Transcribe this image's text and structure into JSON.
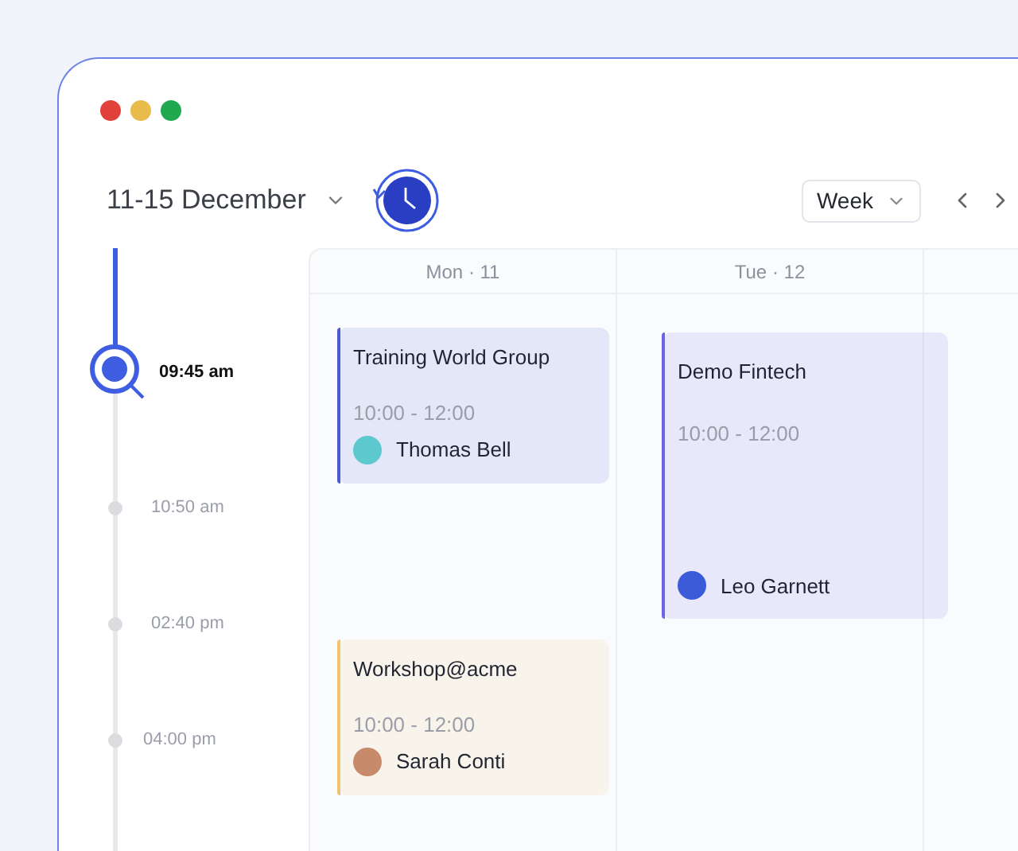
{
  "window": {
    "controls": [
      {
        "color": "#e0413a"
      },
      {
        "color": "#e8bb4a"
      },
      {
        "color": "#20a84f"
      }
    ]
  },
  "header": {
    "date_range": "11-15 December",
    "view": "Week"
  },
  "timeline": [
    {
      "time": "09:45 am",
      "selected": true
    },
    {
      "time": "10:50 am",
      "selected": false
    },
    {
      "time": "02:40 pm",
      "selected": false
    },
    {
      "time": "04:00 pm",
      "selected": false
    }
  ],
  "columns": [
    {
      "heading": "Mon · 11",
      "events": [
        {
          "title": "Training World Group",
          "time": "10:00 - 12:00",
          "person": "Thomas Bell",
          "color": "#4c5bd4",
          "tall": false
        },
        {
          "title": "Workshop@acme",
          "time": "10:00 - 12:00",
          "person": "Sarah Conti",
          "color": "#f0c36e",
          "tall": false
        }
      ]
    },
    {
      "heading": "Tue · 12",
      "events": [
        {
          "title": "Demo Fintech",
          "time": "10:00 - 12:00",
          "person": "Leo Garnett",
          "color": "#6d63e6",
          "tall": true
        }
      ]
    }
  ]
}
